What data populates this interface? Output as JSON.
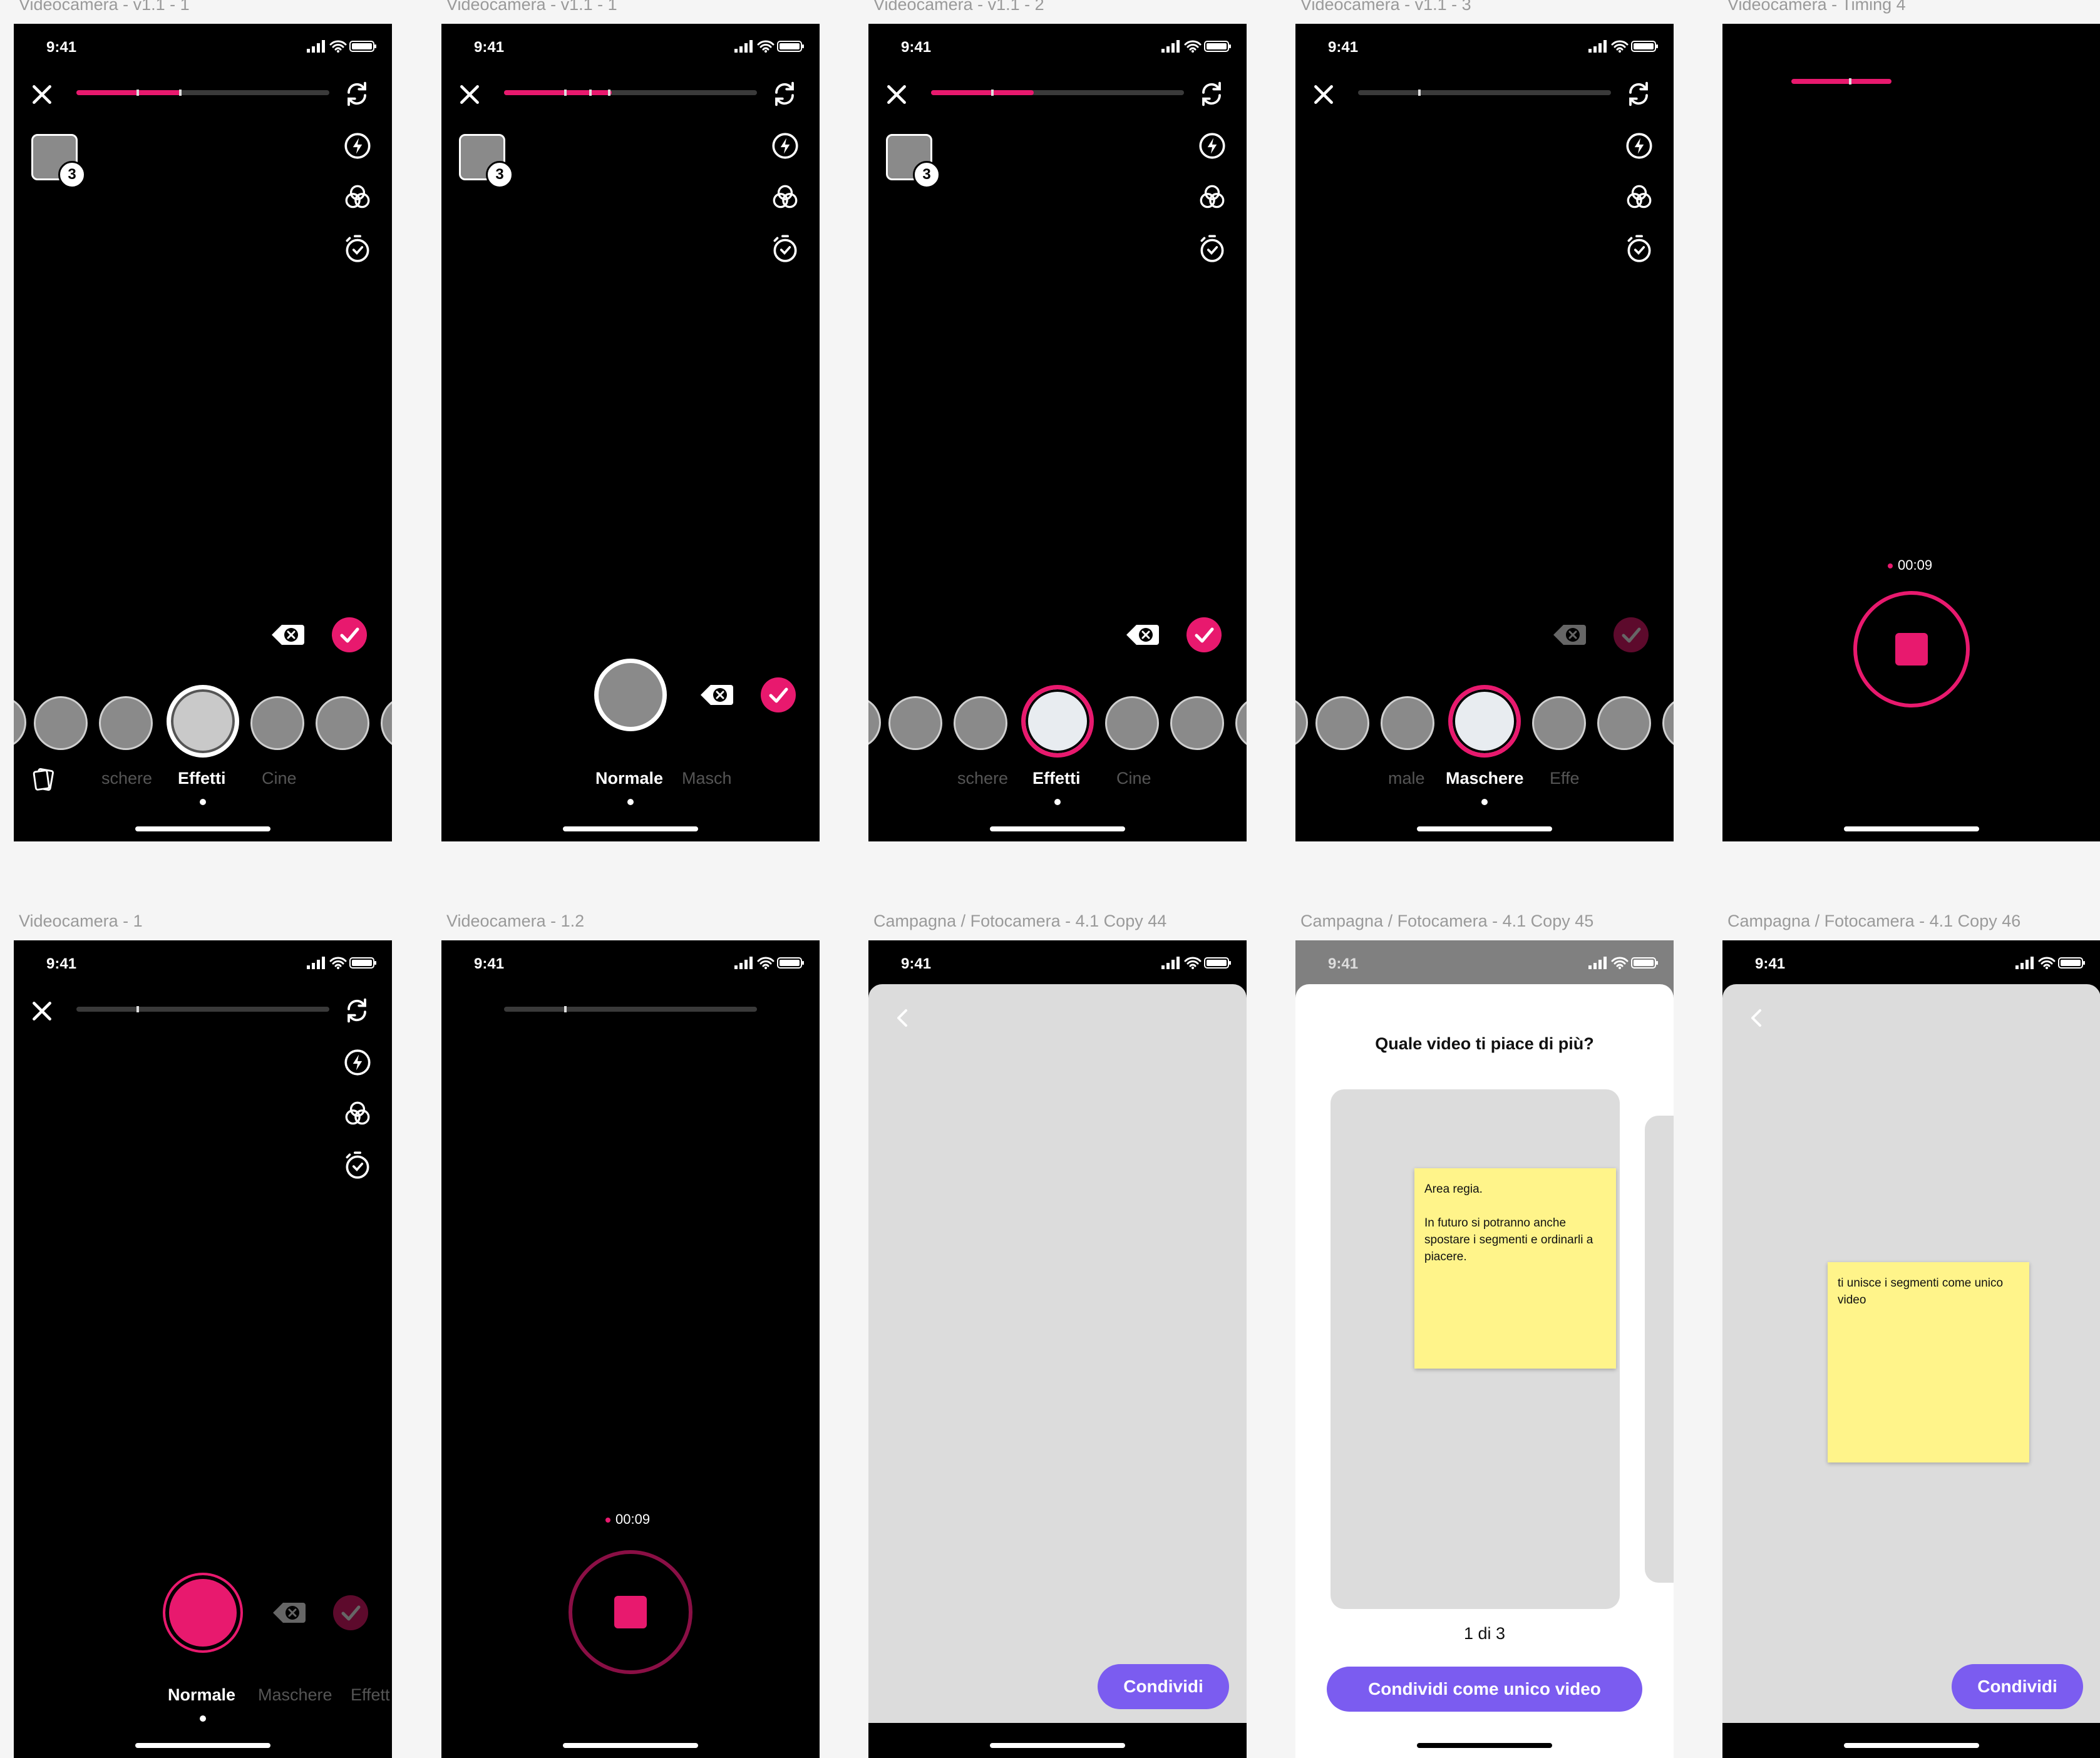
{
  "colors": {
    "accent": "#e8196e",
    "button_purple": "#7b5cf0",
    "sticky_yellow": "#fff48a",
    "canvas_bg": "#f5f5f5",
    "sheet_gray": "#dcdcdc"
  },
  "status_bar": {
    "time": "9:41"
  },
  "frames": {
    "f1": {
      "label": "Videocamera - v1.1 - 1",
      "modes": [
        "schere",
        "Effetti",
        "Cine"
      ],
      "active_mode": "Effetti",
      "clip_count": "3",
      "timeline_progress": 0.4
    },
    "f2": {
      "label": "Videocamera - v1.1 - 1",
      "modes": [
        "Normale",
        "Masch"
      ],
      "active_mode": "Normale",
      "clip_count": "3",
      "timeline_progress": 0.42
    },
    "f3": {
      "label": "Videocamera - v1.1 - 2",
      "modes": [
        "schere",
        "Effetti",
        "Cine"
      ],
      "active_mode": "Effetti",
      "clip_count": "3",
      "timeline_progress": 0.4
    },
    "f4": {
      "label": "Videocamera - v1.1 - 3",
      "modes": [
        "male",
        "Maschere",
        "Effe"
      ],
      "active_mode": "Maschere",
      "timeline_progress": 0.25
    },
    "f5": {
      "label": "Videocamera - Timing 4",
      "timer": "00:09"
    },
    "f6": {
      "label": "Videocamera - 1",
      "modes": [
        "Normale",
        "Maschere",
        "Effett"
      ],
      "active_mode": "Normale",
      "timeline_progress": 0.25
    },
    "f7": {
      "label": "Videocamera - 1.2",
      "timer": "00:09",
      "timeline_progress": 0.25
    },
    "f8": {
      "label": "Campagna / Fotocamera - 4.1 Copy 44",
      "button": "Condividi"
    },
    "f9": {
      "label": "Campagna / Fotocamera - 4.1 Copy 45",
      "title": "Quale video ti piace di più?",
      "sticky": "Area regia.\n\nIn futuro si potranno anche spostare i segmenti e ordinarli a piacere.",
      "counter": "1 di 3",
      "button": "Condividi come unico video"
    },
    "f10": {
      "label": "Campagna / Fotocamera - 4.1 Copy 46",
      "sticky": "ti unisce i segmenti come unico video",
      "button": "Condividi"
    }
  },
  "icons": [
    "close-icon",
    "flip-camera-icon",
    "flash-icon",
    "filters-icon",
    "timer-icon",
    "gallery-icon",
    "delete-icon",
    "confirm-check-icon",
    "back-chevron-icon",
    "signal-icon",
    "wifi-icon",
    "battery-icon"
  ]
}
